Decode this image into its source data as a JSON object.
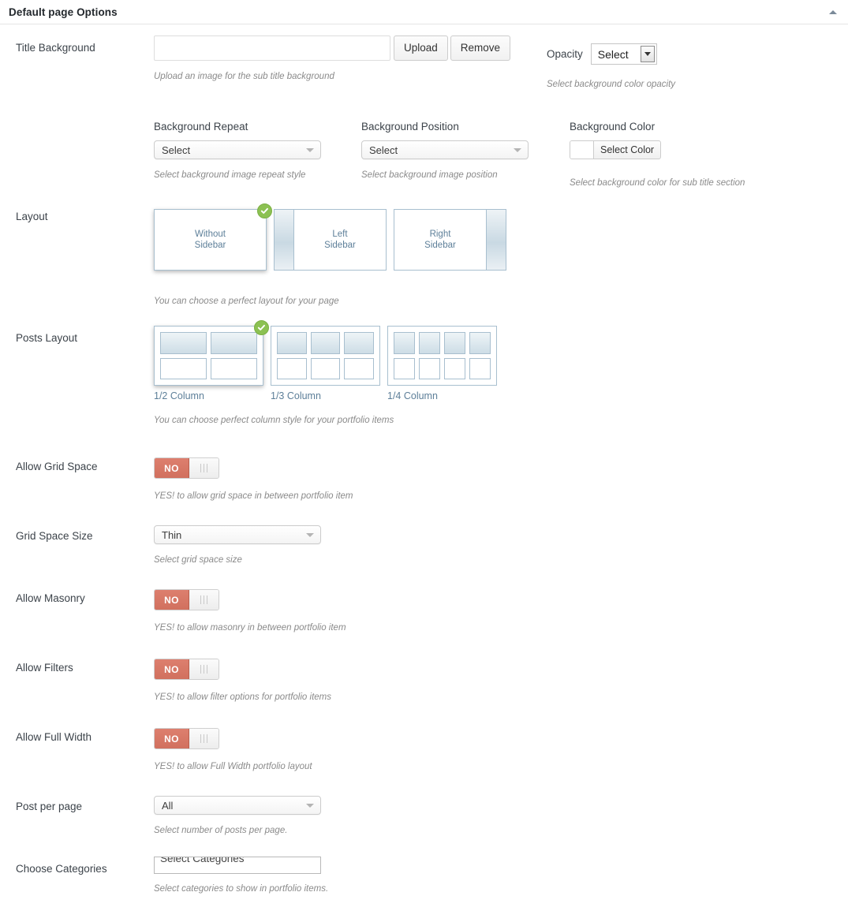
{
  "panel": {
    "title": "Default page Options",
    "collapse_icon": "triangle-up-icon"
  },
  "rows": {
    "title_background": {
      "label": "Title Background",
      "input_value": "",
      "upload_label": "Upload",
      "remove_label": "Remove",
      "desc": "Upload an image for the sub title background"
    },
    "opacity": {
      "label": "Opacity",
      "value": "Select",
      "desc": "Select background color opacity"
    },
    "background_repeat": {
      "label": "Background Repeat",
      "value": "Select",
      "desc": "Select background image repeat style"
    },
    "background_position": {
      "label": "Background Position",
      "value": "Select",
      "desc": "Select background image position"
    },
    "background_color": {
      "label": "Background Color",
      "button_label": "Select Color",
      "swatch_hex": "#ffffff",
      "desc": "Select background color for sub title section"
    },
    "layout": {
      "label": "Layout",
      "desc": "You can choose a perfect layout for your page",
      "options": [
        {
          "label": "Without\nSidebar",
          "line1": "Without",
          "line2": "Sidebar",
          "sidebar": "none",
          "selected": true
        },
        {
          "label": "Left Sidebar",
          "line1": "Left",
          "line2": "Sidebar",
          "sidebar": "left",
          "selected": false
        },
        {
          "label": "Right Sidebar",
          "line1": "Right",
          "line2": "Sidebar",
          "sidebar": "right",
          "selected": false
        }
      ]
    },
    "posts_layout": {
      "label": "Posts Layout",
      "desc": "You can choose perfect column style for your portfolio items",
      "options": [
        {
          "label": "1/2 Column",
          "columns": 2,
          "selected": true
        },
        {
          "label": "1/3 Column",
          "columns": 3,
          "selected": false
        },
        {
          "label": "1/4 Column",
          "columns": 4,
          "selected": false
        }
      ]
    },
    "allow_grid_space": {
      "label": "Allow Grid Space",
      "toggle_state": "NO",
      "desc": "YES! to allow grid space in between portfolio item"
    },
    "grid_space_size": {
      "label": "Grid Space Size",
      "value": "Thin",
      "desc": "Select grid space size"
    },
    "allow_masonry": {
      "label": "Allow Masonry",
      "toggle_state": "NO",
      "desc": "YES! to allow masonry in between portfolio item"
    },
    "allow_filters": {
      "label": "Allow Filters",
      "toggle_state": "NO",
      "desc": "YES! to allow filter options for portfolio items"
    },
    "allow_full_width": {
      "label": "Allow Full Width",
      "toggle_state": "NO",
      "desc": "YES! to allow Full Width portfolio layout"
    },
    "post_per_page": {
      "label": "Post per page",
      "value": "All",
      "desc": "Select number of posts per page."
    },
    "choose_categories": {
      "label": "Choose Categories",
      "placeholder": "Select Categories",
      "value": "",
      "desc": "Select categories to show in portfolio items."
    }
  },
  "colors": {
    "toggle_off": "#d1705e",
    "check_badge": "#8cc152",
    "thumb_border": "#a8bfcf",
    "thumb_text": "#5d7f99"
  }
}
